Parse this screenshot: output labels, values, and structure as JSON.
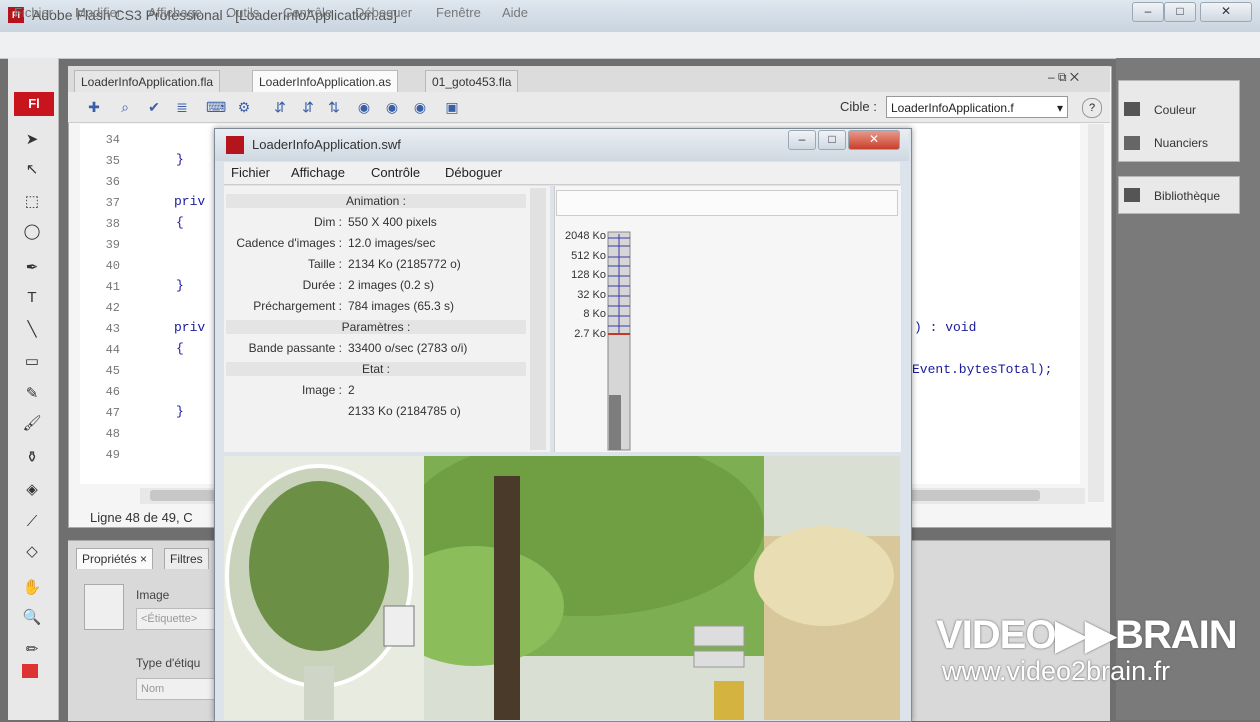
{
  "window": {
    "app_icon": "Fl",
    "title": "Adobe Flash CS3 Professional - [LoaderInfoApplication.as]",
    "controls": [
      "minimize-icon",
      "maximize-icon",
      "close-icon"
    ]
  },
  "menubar": [
    "Fichier",
    "Modifier",
    "Affichage",
    "Outils",
    "Contrôle",
    "Déboguer",
    "Fenêtre",
    "Aide"
  ],
  "tools": {
    "logo": "Fl",
    "icons": [
      "arrow-icon",
      "subselect-icon",
      "free-transform-icon",
      "lasso-icon",
      "pen-icon",
      "text-icon",
      "line-icon",
      "rectangle-icon",
      "pencil-icon",
      "brush-icon",
      "ink-bottle-icon",
      "paint-bucket-icon",
      "eyedropper-icon",
      "eraser-icon",
      "hand-icon",
      "zoom-icon",
      "stroke-color-icon",
      "fill-color-icon"
    ]
  },
  "document": {
    "tabs": [
      "LoaderInfoApplication.fla",
      "LoaderInfoApplication.as",
      "01_goto453.fla"
    ],
    "active_tab": 1,
    "cible_label": "Cible :",
    "cible_value": "LoaderInfoApplication.f",
    "line_numbers": [
      "34",
      "35",
      "36",
      "37",
      "38",
      "39",
      "40",
      "41",
      "42",
      "43",
      "44",
      "45",
      "46",
      "47",
      "48",
      "49"
    ],
    "code": {
      "l35": "}",
      "l37": "priv",
      "l38": "{",
      "l41": "}",
      "l43": "priv",
      "l44": "{",
      "l47": "}",
      "l43_right": ") : void",
      "l45_right": "Event.bytesTotal);"
    },
    "status": "Ligne 48 de 49, C"
  },
  "right_panel": {
    "items": [
      "Couleur",
      "Nuanciers",
      "Bibliothèque"
    ]
  },
  "properties_panel": {
    "tabs": [
      "Propriétés",
      "Filtres"
    ],
    "labels": [
      "Image",
      "<Étiquette>",
      "Type d'étiqu",
      "Nom"
    ]
  },
  "swf_window": {
    "title": "LoaderInfoApplication.swf",
    "menu": [
      "Fichier",
      "Affichage",
      "Contrôle",
      "Déboguer"
    ],
    "sections": {
      "animation": "Animation :",
      "parametres": "Paramètres :",
      "etat": "Etat :"
    },
    "rows": [
      {
        "label": "Dim :",
        "value": "550 X 400 pixels"
      },
      {
        "label": "Cadence d'images :",
        "value": "12.0 images/sec"
      },
      {
        "label": "Taille :",
        "value": "2134 Ko (2185772 o)"
      },
      {
        "label": "Durée :",
        "value": "2 images (0.2 s)"
      },
      {
        "label": "Préchargement :",
        "value": "784 images (65.3 s)"
      },
      {
        "label": "Bande passante :",
        "value": "33400 o/sec (2783 o/i)"
      },
      {
        "label": "Image :",
        "value": "2"
      },
      {
        "label": "",
        "value": "2133 Ko (2184785 o)"
      }
    ],
    "graph_labels": [
      "2048 Ko",
      "512 Ko",
      "128 Ko",
      "32 Ko",
      "8 Ko",
      "2.7 Ko"
    ],
    "graph_level": 0.25
  },
  "watermark": {
    "brand": "VIDEO▶▶BRAIN",
    "url": "www.video2brain.fr"
  },
  "colors": {
    "flash_red": "#c8141c",
    "code_blue": "#1a1a9a",
    "graph_red": "#c0392b",
    "graph_blue": "#3a3aa8"
  }
}
